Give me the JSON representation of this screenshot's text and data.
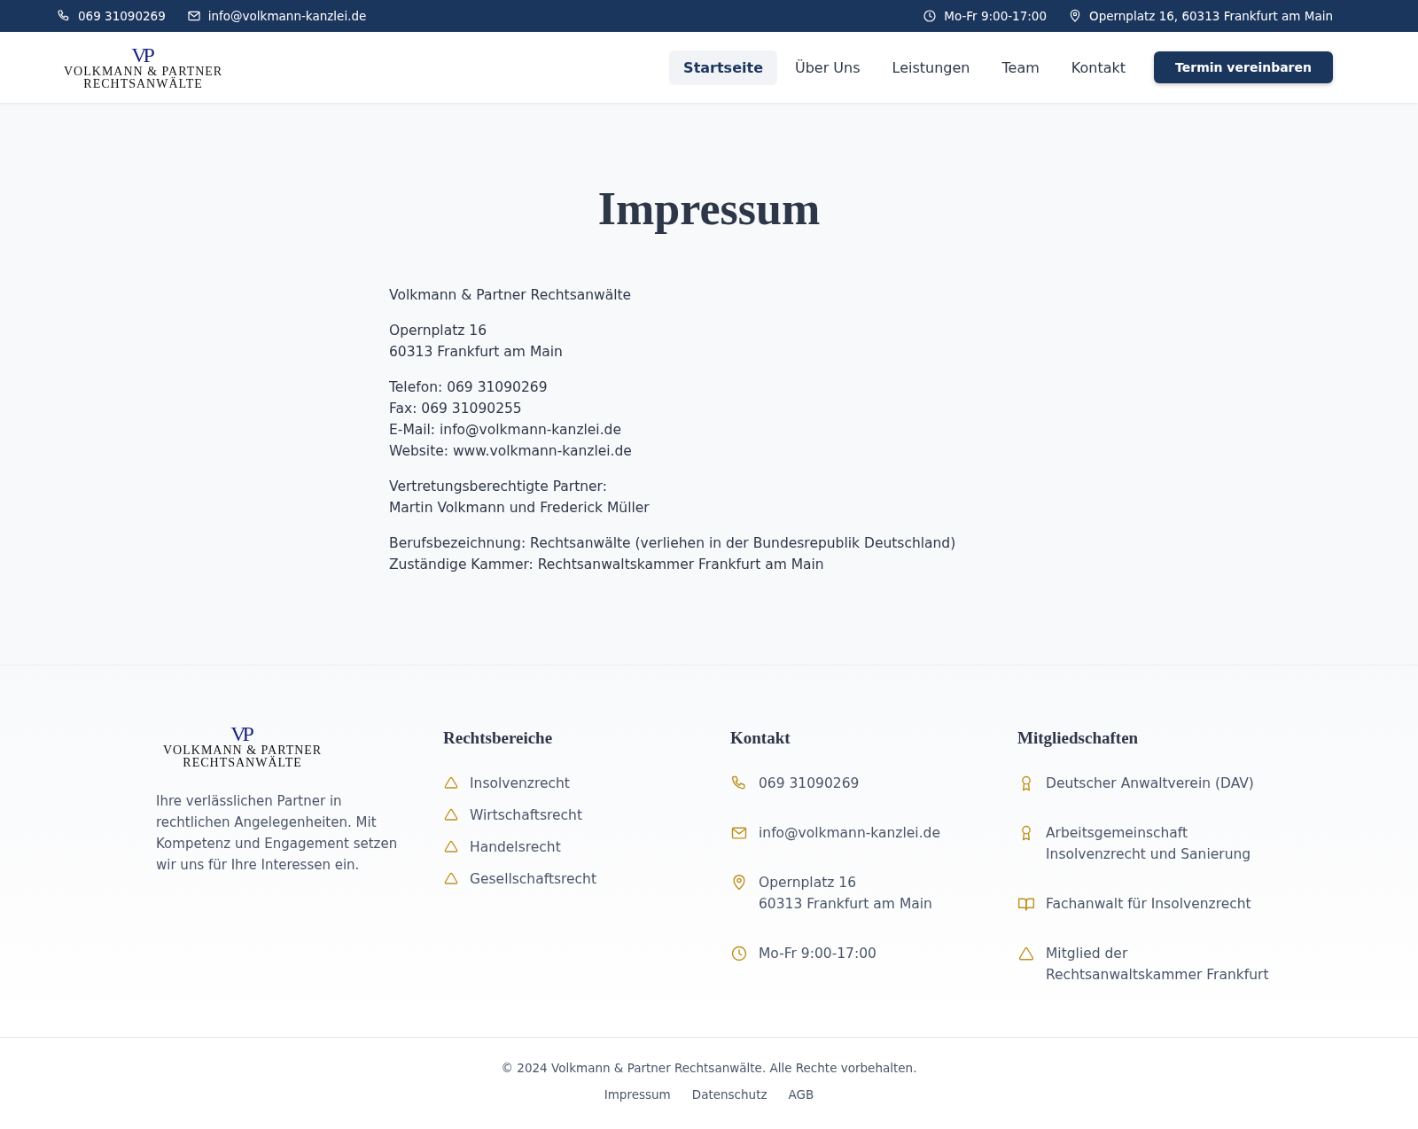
{
  "top_bar": {
    "left": [
      {
        "kind": "phone",
        "text": "069 31090269"
      },
      {
        "kind": "mail",
        "text": "info@volkmann-kanzlei.de"
      }
    ],
    "right": [
      {
        "kind": "clock",
        "text": "Mo-Fr 9:00-17:00"
      },
      {
        "kind": "pin",
        "text": "Opernplatz 16, 60313 Frankfurt am Main"
      }
    ]
  },
  "logo": {
    "monogram": "VP",
    "name": "VOLKMANN & PARTNER",
    "sub": "RECHTSANWÄLTE"
  },
  "nav": [
    {
      "label": "Startseite",
      "selected": true
    },
    {
      "label": "Über Uns",
      "selected": false
    },
    {
      "label": "Leistungen",
      "selected": false
    },
    {
      "label": "Team",
      "selected": false
    },
    {
      "label": "Kontakt",
      "selected": false
    }
  ],
  "cta_button": "Termin vereinbaren",
  "page_title": "Impressum",
  "paragraphs": [
    [
      "Volkmann & Partner Rechtsanwälte"
    ],
    [
      "Opernplatz 16",
      "60313 Frankfurt am Main"
    ],
    [
      "Telefon: 069 31090269",
      "Fax: 069 31090255",
      "E-Mail: info@volkmann-kanzlei.de",
      "Website: www.volkmann-kanzlei.de"
    ],
    [
      "Vertretungsberechtigte Partner:",
      "Martin Volkmann und Frederick Müller"
    ],
    [
      "Berufsbezeichnung: Rechtsanwälte (verliehen in der Bundesrepublik Deutschland)",
      "Zuständige Kammer: Rechtsanwaltskammer Frankfurt am Main"
    ]
  ],
  "footer": {
    "logo": {
      "monogram": "VP",
      "name": "VOLKMANN & PARTNER",
      "sub": "RECHTSANWÄLTE"
    },
    "about": "Ihre verlässlichen Partner in rechtlichen Angelegenheiten. Mit Kompetenz und Engagement setzen wir uns für Ihre Interessen ein.",
    "columns": [
      {
        "title": "Rechtsbereiche",
        "items": [
          {
            "kind": "triangle",
            "lines": [
              "Insolvenzrecht"
            ]
          },
          {
            "kind": "triangle",
            "lines": [
              "Wirtschaftsrecht"
            ]
          },
          {
            "kind": "triangle",
            "lines": [
              "Handelsrecht"
            ]
          },
          {
            "kind": "triangle",
            "lines": [
              "Gesellschaftsrecht"
            ]
          }
        ]
      },
      {
        "title": "Kontakt",
        "items": [
          {
            "kind": "phone",
            "lines": [
              "069 31090269"
            ]
          },
          {
            "kind": "mail",
            "lines": [
              "info@volkmann-kanzlei.de"
            ]
          },
          {
            "kind": "pin",
            "lines": [
              "Opernplatz 16",
              "60313 Frankfurt am Main"
            ]
          },
          {
            "kind": "clock",
            "lines": [
              "Mo-Fr 9:00-17:00"
            ]
          }
        ]
      },
      {
        "title": "Mitgliedschaften",
        "items": [
          {
            "kind": "award",
            "lines": [
              "Deutscher Anwaltverein (DAV)"
            ]
          },
          {
            "kind": "award",
            "lines": [
              "Arbeitsgemeinschaft",
              "Insolvenzrecht und Sanierung"
            ]
          },
          {
            "kind": "book",
            "lines": [
              "Fachanwalt für Insolvenzrecht"
            ]
          },
          {
            "kind": "triangle",
            "lines": [
              "Mitglied der",
              "Rechtsanwaltskammer Frankfurt"
            ]
          }
        ]
      }
    ]
  },
  "copyright": "© 2024 Volkmann & Partner Rechtsanwälte. Alle Rechte vorbehalten.",
  "bottom_links": [
    "Impressum",
    "Datenschutz",
    "AGB"
  ]
}
